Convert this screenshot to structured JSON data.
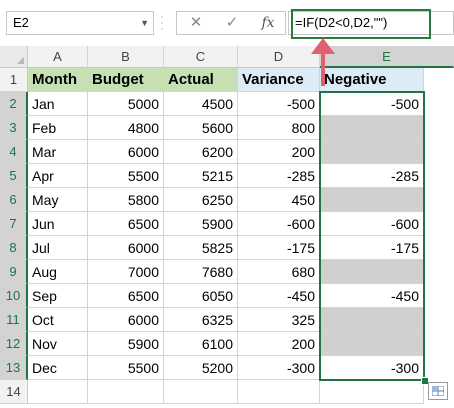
{
  "name_box": {
    "value": "E2"
  },
  "formula_bar": {
    "cancel_glyph": "✕",
    "enter_glyph": "✓",
    "function_label": "fx",
    "formula": "=IF(D2<0,D2,\"\")"
  },
  "columns": [
    "A",
    "B",
    "C",
    "D",
    "E"
  ],
  "rows": [
    "1",
    "2",
    "3",
    "4",
    "5",
    "6",
    "7",
    "8",
    "9",
    "10",
    "11",
    "12",
    "13",
    "14"
  ],
  "headers": {
    "month": "Month",
    "budget": "Budget",
    "actual": "Actual",
    "variance": "Variance",
    "negative": "Negative"
  },
  "data": [
    {
      "month": "Jan",
      "budget": "5000",
      "actual": "4500",
      "variance": "-500",
      "negative": "-500"
    },
    {
      "month": "Feb",
      "budget": "4800",
      "actual": "5600",
      "variance": "800",
      "negative": ""
    },
    {
      "month": "Mar",
      "budget": "6000",
      "actual": "6200",
      "variance": "200",
      "negative": ""
    },
    {
      "month": "Apr",
      "budget": "5500",
      "actual": "5215",
      "variance": "-285",
      "negative": "-285"
    },
    {
      "month": "May",
      "budget": "5800",
      "actual": "6250",
      "variance": "450",
      "negative": ""
    },
    {
      "month": "Jun",
      "budget": "6500",
      "actual": "5900",
      "variance": "-600",
      "negative": "-600"
    },
    {
      "month": "Jul",
      "budget": "6000",
      "actual": "5825",
      "variance": "-175",
      "negative": "-175"
    },
    {
      "month": "Aug",
      "budget": "7000",
      "actual": "7680",
      "variance": "680",
      "negative": ""
    },
    {
      "month": "Sep",
      "budget": "6500",
      "actual": "6050",
      "variance": "-450",
      "negative": "-450"
    },
    {
      "month": "Oct",
      "budget": "6000",
      "actual": "6325",
      "variance": "325",
      "negative": ""
    },
    {
      "month": "Nov",
      "budget": "5900",
      "actual": "6100",
      "variance": "200",
      "negative": ""
    },
    {
      "month": "Dec",
      "budget": "5500",
      "actual": "5200",
      "variance": "-300",
      "negative": "-300"
    }
  ],
  "colors": {
    "header_green": "#c6e0b4",
    "header_blue": "#ddebf7",
    "empty_gray": "#d0d0d0",
    "selection_green": "#217346",
    "arrow_red": "#e06070"
  }
}
